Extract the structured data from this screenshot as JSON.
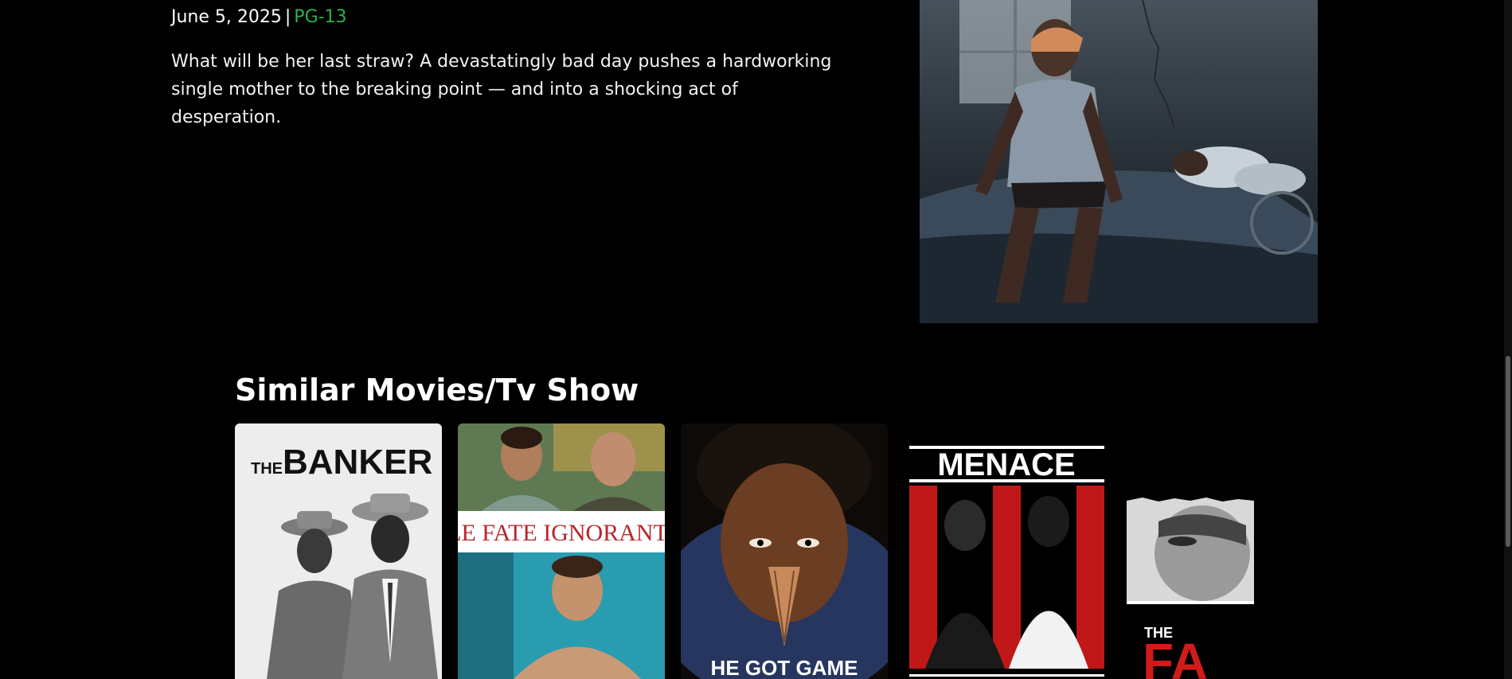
{
  "details": {
    "release_date": "June 5, 2025",
    "separator": "|",
    "rating": "PG-13",
    "rating_color": "#2bb24c",
    "synopsis": "What will be her last straw? A devastatingly bad day pushes a hardworking single mother to the breaking point — and into a shocking act of desperation."
  },
  "similar": {
    "heading": "Similar Movies/Tv Show",
    "cards": [
      {
        "poster_text_1": "THE",
        "poster_text_2": "BANKER"
      },
      {
        "poster_text": "LE FATE IGNORANTI"
      },
      {
        "poster_text": "HE GOT GAME"
      },
      {
        "poster_text": "MENACE"
      },
      {
        "poster_text_1": "THE",
        "poster_text_2": "FA"
      }
    ]
  }
}
